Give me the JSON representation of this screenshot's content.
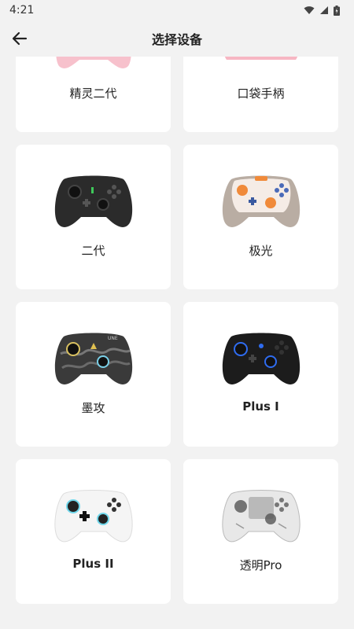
{
  "status_bar": {
    "time": "4:21"
  },
  "header": {
    "title": "选择设备"
  },
  "devices": [
    {
      "label": "精灵二代",
      "icon": "pink-controller"
    },
    {
      "label": "口袋手柄",
      "icon": "pink-pocket-controller"
    },
    {
      "label": "二代",
      "icon": "black-controller"
    },
    {
      "label": "极光",
      "icon": "cream-orange-controller"
    },
    {
      "label": "墨攻",
      "icon": "camo-controller"
    },
    {
      "label": "Plus I",
      "icon": "black-blue-controller"
    },
    {
      "label": "Plus II",
      "icon": "white-controller"
    },
    {
      "label": "透明Pro",
      "icon": "transparent-controller"
    }
  ]
}
